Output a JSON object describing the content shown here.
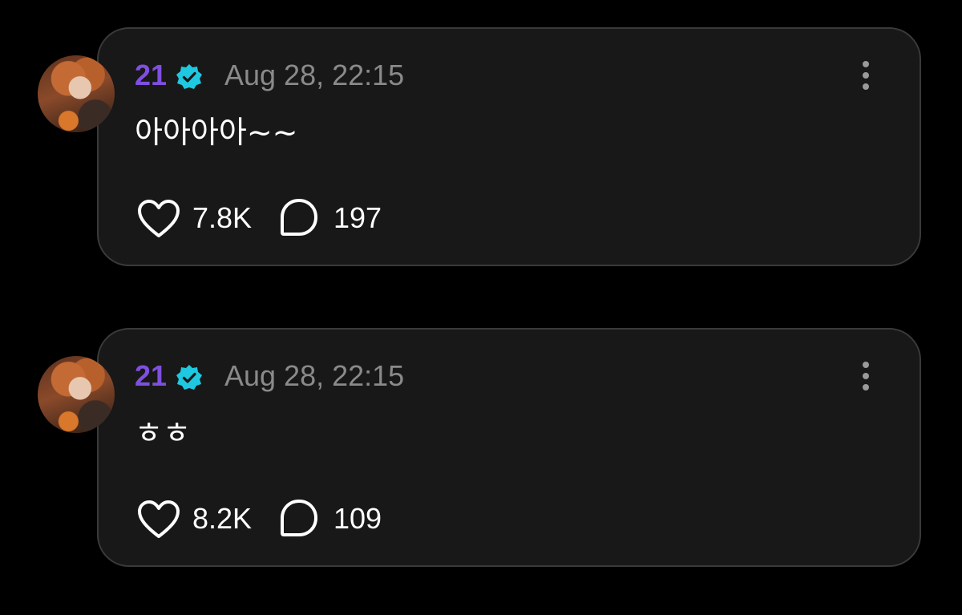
{
  "posts": [
    {
      "author": "21",
      "verified_icon": "verified-badge-icon",
      "timestamp": "Aug 28, 22:15",
      "text": "아아아아~~",
      "likes": "7.8K",
      "replies": "197"
    },
    {
      "author": "21",
      "verified_icon": "verified-badge-icon",
      "timestamp": "Aug 28, 22:15",
      "text": "ㅎㅎ",
      "likes": "8.2K",
      "replies": "109"
    }
  ],
  "colors": {
    "background": "#000000",
    "card": "#181818",
    "card_border": "#3a3a3a",
    "author": "#7f4fe0",
    "verified": "#1ec8e0",
    "timestamp": "#8a8a8a",
    "text": "#ffffff"
  }
}
